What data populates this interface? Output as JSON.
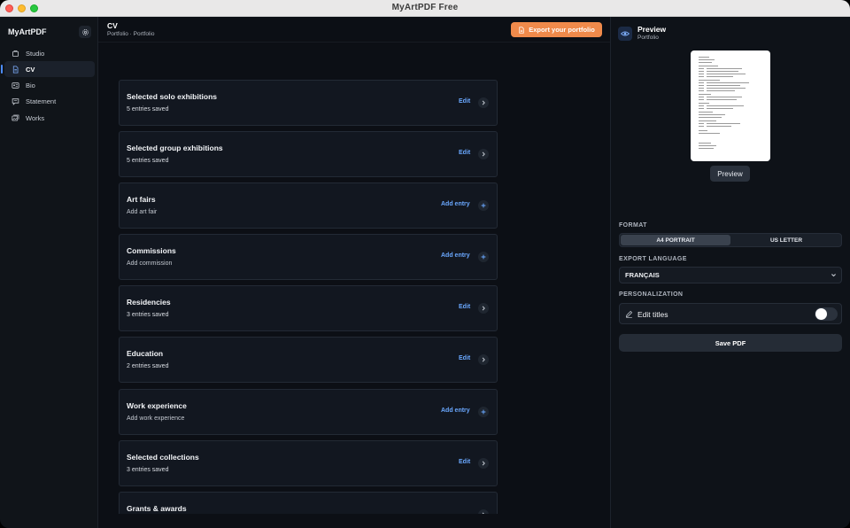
{
  "window": {
    "title": "MyArtPDF Free"
  },
  "sidebar": {
    "brand": "MyArtPDF",
    "items": [
      {
        "label": "Studio",
        "icon": "studio-icon",
        "active": false
      },
      {
        "label": "CV",
        "icon": "document-icon",
        "active": true
      },
      {
        "label": "Bio",
        "icon": "id-card-icon",
        "active": false
      },
      {
        "label": "Statement",
        "icon": "speech-bubble-icon",
        "active": false
      },
      {
        "label": "Works",
        "icon": "images-icon",
        "active": false
      }
    ]
  },
  "header": {
    "title": "CV",
    "breadcrumb": "Portfolio · Portfolio",
    "export_label": "Export your portfolio"
  },
  "sections": [
    {
      "title": "Selected solo exhibitions",
      "subtitle": "5 entries saved",
      "action": "Edit"
    },
    {
      "title": "Selected group exhibitions",
      "subtitle": "5 entries saved",
      "action": "Edit"
    },
    {
      "title": "Art fairs",
      "subtitle": "Add art fair",
      "action": "Add entry"
    },
    {
      "title": "Commissions",
      "subtitle": "Add commission",
      "action": "Add entry"
    },
    {
      "title": "Residencies",
      "subtitle": "3 entries saved",
      "action": "Edit"
    },
    {
      "title": "Education",
      "subtitle": "2 entries saved",
      "action": "Edit"
    },
    {
      "title": "Work experience",
      "subtitle": "Add work experience",
      "action": "Add entry"
    },
    {
      "title": "Selected collections",
      "subtitle": "3 entries saved",
      "action": "Edit"
    },
    {
      "title": "Grants & awards",
      "subtitle": "",
      "action": ""
    }
  ],
  "preview_panel": {
    "title": "Preview",
    "subtitle": "Portfolio",
    "preview_button": "Preview",
    "format_label": "FORMAT",
    "format_options": [
      "A4 PORTRAIT",
      "US LETTER"
    ],
    "format_selected": "A4 PORTRAIT",
    "language_label": "EXPORT LANGUAGE",
    "language_value": "FRANÇAIS",
    "personalization_label": "PERSONALIZATION",
    "edit_titles_label": "Edit titles",
    "edit_titles_on": false,
    "save_label": "Save PDF"
  },
  "colors": {
    "accent_orange": "#f08a4b",
    "link_blue": "#6aa8ff",
    "active_indicator": "#4d8dff"
  }
}
